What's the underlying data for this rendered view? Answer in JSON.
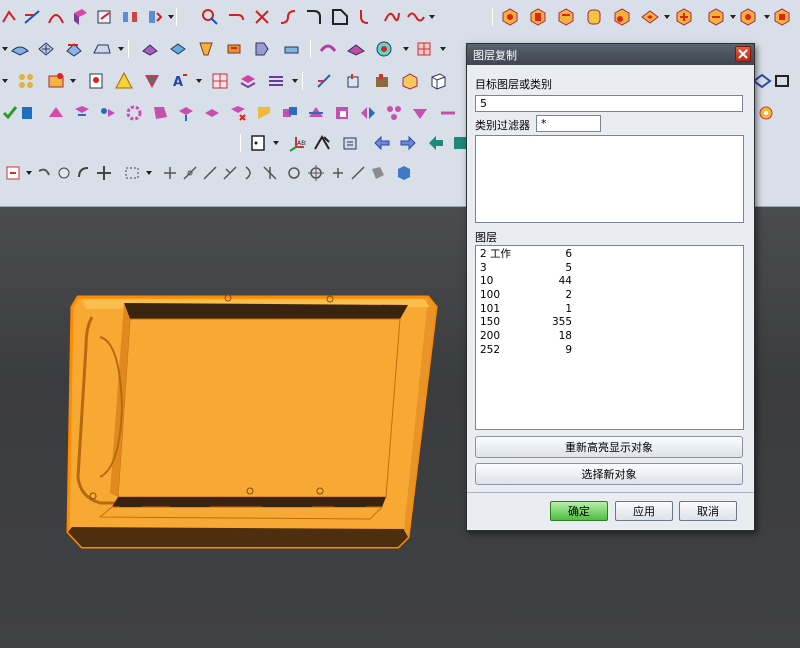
{
  "dialog": {
    "title": "图层复制",
    "target_label": "目标图层或类别",
    "target_value": "5",
    "filter_label": "类别过滤器",
    "filter_value": "*",
    "layers_label": "图层",
    "layers": [
      {
        "layer": "2 工作",
        "count": "6"
      },
      {
        "layer": "3",
        "count": "5"
      },
      {
        "layer": "10",
        "count": "44"
      },
      {
        "layer": "100",
        "count": "2"
      },
      {
        "layer": "101",
        "count": "1"
      },
      {
        "layer": "150",
        "count": "355"
      },
      {
        "layer": "200",
        "count": "18"
      },
      {
        "layer": "252",
        "count": "9"
      }
    ],
    "rehighlight_label": "重新高亮显示对象",
    "select_new_label": "选择新对象",
    "ok_label": "确定",
    "apply_label": "应用",
    "cancel_label": "取消"
  },
  "colors": {
    "toolbar_bg": "#d9dfe8",
    "viewport_bg": "#3f4043",
    "part_orange": "#f7a933",
    "part_outline": "#ff8a00",
    "ok_green": "#4fbe41"
  }
}
